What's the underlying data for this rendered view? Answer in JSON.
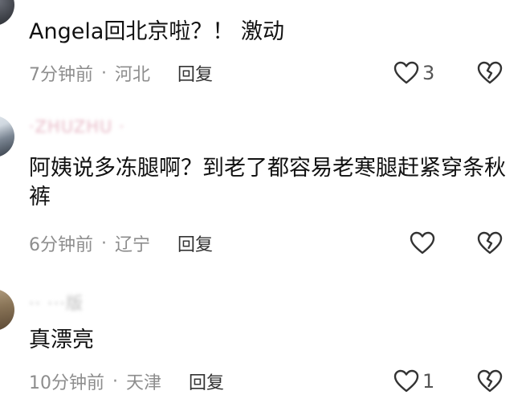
{
  "comments": [
    {
      "username": "··· ··",
      "text": "Angela回北京啦？！ 激动",
      "time": "7分钟前",
      "separator": "·",
      "location": "河北",
      "reply_label": "回复",
      "like_count": "3"
    },
    {
      "username": "·ZHUZHU ·",
      "text": "阿姨说多冻腿啊？到老了都容易老寒腿赶紧穿条秋裤",
      "time": "6分钟前",
      "separator": "·",
      "location": "辽宁",
      "reply_label": "回复",
      "like_count": ""
    },
    {
      "username": "·· ···版",
      "text": "真漂亮",
      "time": "10分钟前",
      "separator": "·",
      "location": "天津",
      "reply_label": "回复",
      "like_count": "1"
    }
  ],
  "icons": {
    "like": "heart-outline-icon",
    "dislike": "broken-heart-icon"
  },
  "colors": {
    "text": "#111111",
    "meta": "#8d8d8d",
    "reply": "#333333",
    "icon": "#333333"
  }
}
